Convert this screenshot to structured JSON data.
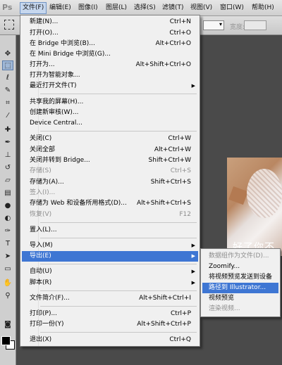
{
  "app": {
    "logo": "Ps"
  },
  "menubar": {
    "items": [
      "文件(F)",
      "编辑(E)",
      "图像(I)",
      "图层(L)",
      "选择(S)",
      "滤镜(T)",
      "视图(V)",
      "窗口(W)",
      "帮助(H)"
    ]
  },
  "options": {
    "width_label": "宽度:",
    "dropdown_arrow": "▾"
  },
  "tools": [
    "move-tool",
    "rect-marquee-tool",
    "lasso-tool",
    "quick-select-tool",
    "crop-tool",
    "eyedropper-tool",
    "healing-brush-tool",
    "brush-tool",
    "clone-stamp-tool",
    "history-brush-tool",
    "eraser-tool",
    "gradient-tool",
    "blur-tool",
    "dodge-tool",
    "pen-tool",
    "type-tool",
    "path-select-tool",
    "rectangle-tool",
    "hand-tool",
    "zoom-tool"
  ],
  "canvas": {
    "caption": "好了你不"
  },
  "file_menu": {
    "items": [
      {
        "label": "新建(N)...",
        "shortcut": "Ctrl+N"
      },
      {
        "label": "打开(O)...",
        "shortcut": "Ctrl+O"
      },
      {
        "label": "在 Bridge 中浏览(B)...",
        "shortcut": "Alt+Ctrl+O"
      },
      {
        "label": "在 Mini Bridge 中浏览(G)...",
        "shortcut": ""
      },
      {
        "label": "打开为...",
        "shortcut": "Alt+Shift+Ctrl+O"
      },
      {
        "label": "打开为智能对象...",
        "shortcut": ""
      },
      {
        "label": "最近打开文件(T)",
        "shortcut": ""
      },
      {
        "label": "共享我的屏幕(H)...",
        "shortcut": ""
      },
      {
        "label": "创建新审核(W)...",
        "shortcut": ""
      },
      {
        "label": "Device Central...",
        "shortcut": ""
      },
      {
        "label": "关闭(C)",
        "shortcut": "Ctrl+W"
      },
      {
        "label": "关闭全部",
        "shortcut": "Alt+Ctrl+W"
      },
      {
        "label": "关闭并转到 Bridge...",
        "shortcut": "Shift+Ctrl+W"
      },
      {
        "label": "存储(S)",
        "shortcut": "Ctrl+S"
      },
      {
        "label": "存储为(A)...",
        "shortcut": "Shift+Ctrl+S"
      },
      {
        "label": "签入(I)...",
        "shortcut": ""
      },
      {
        "label": "存储为 Web 和设备所用格式(D)...",
        "shortcut": "Alt+Shift+Ctrl+S"
      },
      {
        "label": "恢复(V)",
        "shortcut": "F12"
      },
      {
        "label": "置入(L)...",
        "shortcut": ""
      },
      {
        "label": "导入(M)",
        "shortcut": ""
      },
      {
        "label": "导出(E)",
        "shortcut": ""
      },
      {
        "label": "自动(U)",
        "shortcut": ""
      },
      {
        "label": "脚本(R)",
        "shortcut": ""
      },
      {
        "label": "文件简介(F)...",
        "shortcut": "Alt+Shift+Ctrl+I"
      },
      {
        "label": "打印(P)...",
        "shortcut": "Ctrl+P"
      },
      {
        "label": "打印一份(Y)",
        "shortcut": "Alt+Shift+Ctrl+P"
      },
      {
        "label": "退出(X)",
        "shortcut": "Ctrl+Q"
      }
    ],
    "submenu_arrow": "▶"
  },
  "export_submenu": {
    "items": [
      {
        "label": "数据组作为文件(D)..."
      },
      {
        "label": "Zoomify..."
      },
      {
        "label": "将视频预览发送到设备"
      },
      {
        "label": "路径到 Illustrator..."
      },
      {
        "label": "视频预览"
      },
      {
        "label": "渲染视频..."
      }
    ]
  }
}
